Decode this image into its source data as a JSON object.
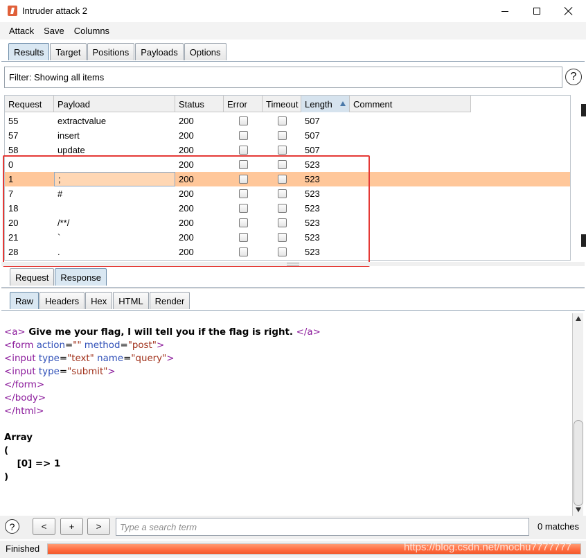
{
  "window": {
    "title": "Intruder attack 2"
  },
  "menu": [
    "Attack",
    "Save",
    "Columns"
  ],
  "top_tabs": [
    "Results",
    "Target",
    "Positions",
    "Payloads",
    "Options"
  ],
  "filter": {
    "text": "Filter: Showing all items"
  },
  "table": {
    "columns": [
      "Request",
      "Payload",
      "Status",
      "Error",
      "Timeout",
      "Length",
      "Comment"
    ],
    "sorted_column": "Length",
    "rows": [
      {
        "request": "55",
        "payload": "extractvalue",
        "status": "200",
        "error": false,
        "timeout": false,
        "length": "507"
      },
      {
        "request": "57",
        "payload": "insert",
        "status": "200",
        "error": false,
        "timeout": false,
        "length": "507"
      },
      {
        "request": "58",
        "payload": "update",
        "status": "200",
        "error": false,
        "timeout": false,
        "length": "507"
      },
      {
        "request": "0",
        "payload": "",
        "status": "200",
        "error": false,
        "timeout": false,
        "length": "523"
      },
      {
        "request": "1",
        "payload": ";",
        "status": "200",
        "error": false,
        "timeout": false,
        "length": "523",
        "selected": true
      },
      {
        "request": "7",
        "payload": "#",
        "status": "200",
        "error": false,
        "timeout": false,
        "length": "523"
      },
      {
        "request": "18",
        "payload": "",
        "status": "200",
        "error": false,
        "timeout": false,
        "length": "523"
      },
      {
        "request": "20",
        "payload": "/**/",
        "status": "200",
        "error": false,
        "timeout": false,
        "length": "523"
      },
      {
        "request": "21",
        "payload": "`",
        "status": "200",
        "error": false,
        "timeout": false,
        "length": "523"
      },
      {
        "request": "28",
        "payload": ".",
        "status": "200",
        "error": false,
        "timeout": false,
        "length": "523"
      }
    ]
  },
  "message_tabs": [
    "Request",
    "Response"
  ],
  "view_tabs": [
    "Raw",
    "Headers",
    "Hex",
    "HTML",
    "Render"
  ],
  "response": {
    "line1_open": "<a>",
    "line1_text": " Give me your flag, I will tell you if the flag is right. ",
    "line1_close": "</a>",
    "form_open": "<form",
    "form_action_attr": " action",
    "form_eq1": "=",
    "form_action_val": "\"\"",
    "form_method_attr": " method",
    "form_eq2": "=",
    "form_method_val": "\"post\"",
    "form_gt": ">",
    "input1_open": "<input",
    "input1_type_attr": " type",
    "input1_eq1": "=",
    "input1_type_val": "\"text\"",
    "input1_name_attr": " name",
    "input1_eq2": "=",
    "input1_name_val": "\"query\"",
    "input1_gt": ">",
    "input2_open": "<input",
    "input2_type_attr": " type",
    "input2_eq": "=",
    "input2_type_val": "\"submit\"",
    "input2_gt": ">",
    "form_close": "</form>",
    "body_close": "</body>",
    "html_close": "</html>",
    "array_label": "Array",
    "paren_open": "(",
    "array_entry": "    [0] => 1",
    "paren_close": ")"
  },
  "search": {
    "help_label": "?",
    "prev_label": "<",
    "add_label": "+",
    "next_label": ">",
    "placeholder": "Type a search term",
    "matches": "0 matches"
  },
  "status": {
    "text": "Finished",
    "progress": 1.0
  },
  "watermark": "https://blog.csdn.net/mochu7777777",
  "colors": {
    "selected_row": "#ffc79a",
    "progress": "#ff6a3d",
    "highlight_box": "#e53935"
  }
}
